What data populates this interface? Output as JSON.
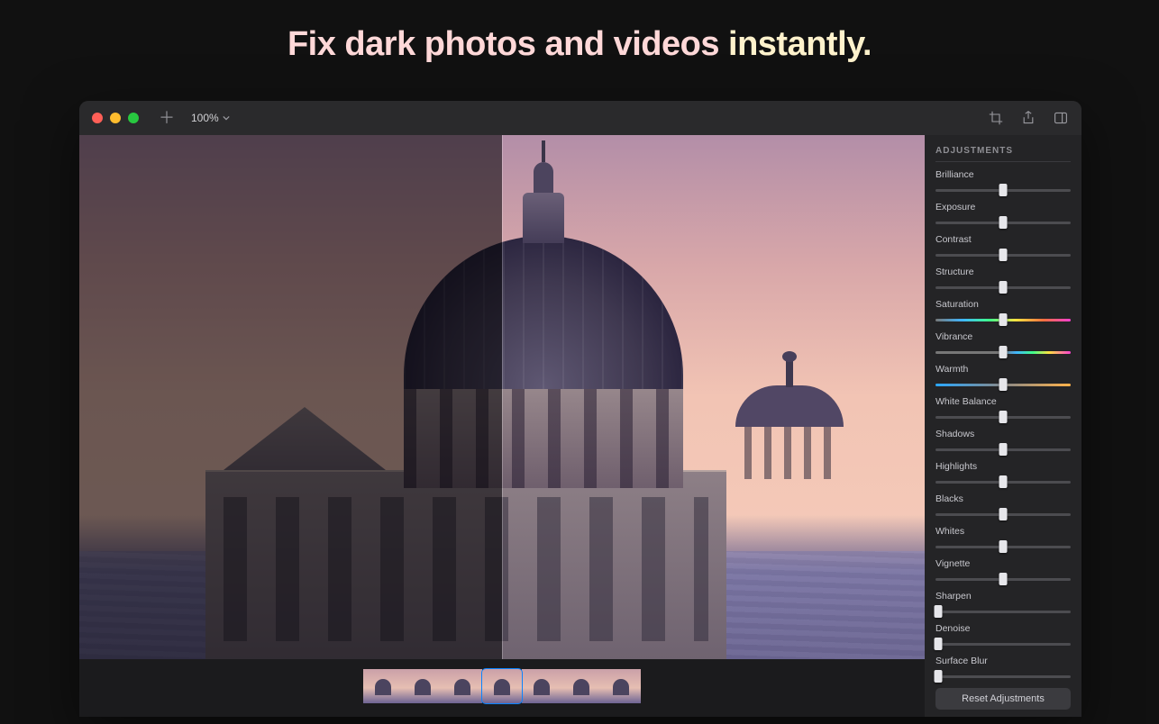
{
  "hero": {
    "part1": "Fix dark photos and videos ",
    "part2": "instantly."
  },
  "titlebar": {
    "zoom_label": "100%",
    "tools": {
      "add": "add-button",
      "crop": "crop-icon",
      "share": "share-icon",
      "sidebar": "sidebar-toggle-icon"
    }
  },
  "filmstrip": {
    "count": 7,
    "selected_index": 3
  },
  "panel": {
    "title": "ADJUSTMENTS",
    "reset_label": "Reset Adjustments",
    "sliders": [
      {
        "id": "brilliance",
        "label": "Brilliance",
        "value": 50,
        "variant": "plain"
      },
      {
        "id": "exposure",
        "label": "Exposure",
        "value": 50,
        "variant": "plain"
      },
      {
        "id": "contrast",
        "label": "Contrast",
        "value": 50,
        "variant": "plain"
      },
      {
        "id": "structure",
        "label": "Structure",
        "value": 50,
        "variant": "plain"
      },
      {
        "id": "saturation",
        "label": "Saturation",
        "value": 50,
        "variant": "sat"
      },
      {
        "id": "vibrance",
        "label": "Vibrance",
        "value": 50,
        "variant": "vib"
      },
      {
        "id": "warmth",
        "label": "Warmth",
        "value": 50,
        "variant": "warm"
      },
      {
        "id": "white-balance",
        "label": "White Balance",
        "value": 50,
        "variant": "plain"
      },
      {
        "id": "shadows",
        "label": "Shadows",
        "value": 50,
        "variant": "plain"
      },
      {
        "id": "highlights",
        "label": "Highlights",
        "value": 50,
        "variant": "plain"
      },
      {
        "id": "blacks",
        "label": "Blacks",
        "value": 50,
        "variant": "plain"
      },
      {
        "id": "whites",
        "label": "Whites",
        "value": 50,
        "variant": "plain"
      },
      {
        "id": "vignette",
        "label": "Vignette",
        "value": 50,
        "variant": "plain"
      },
      {
        "id": "sharpen",
        "label": "Sharpen",
        "value": 2,
        "variant": "plain"
      },
      {
        "id": "denoise",
        "label": "Denoise",
        "value": 2,
        "variant": "plain"
      },
      {
        "id": "surface-blur",
        "label": "Surface Blur",
        "value": 2,
        "variant": "plain"
      }
    ]
  }
}
